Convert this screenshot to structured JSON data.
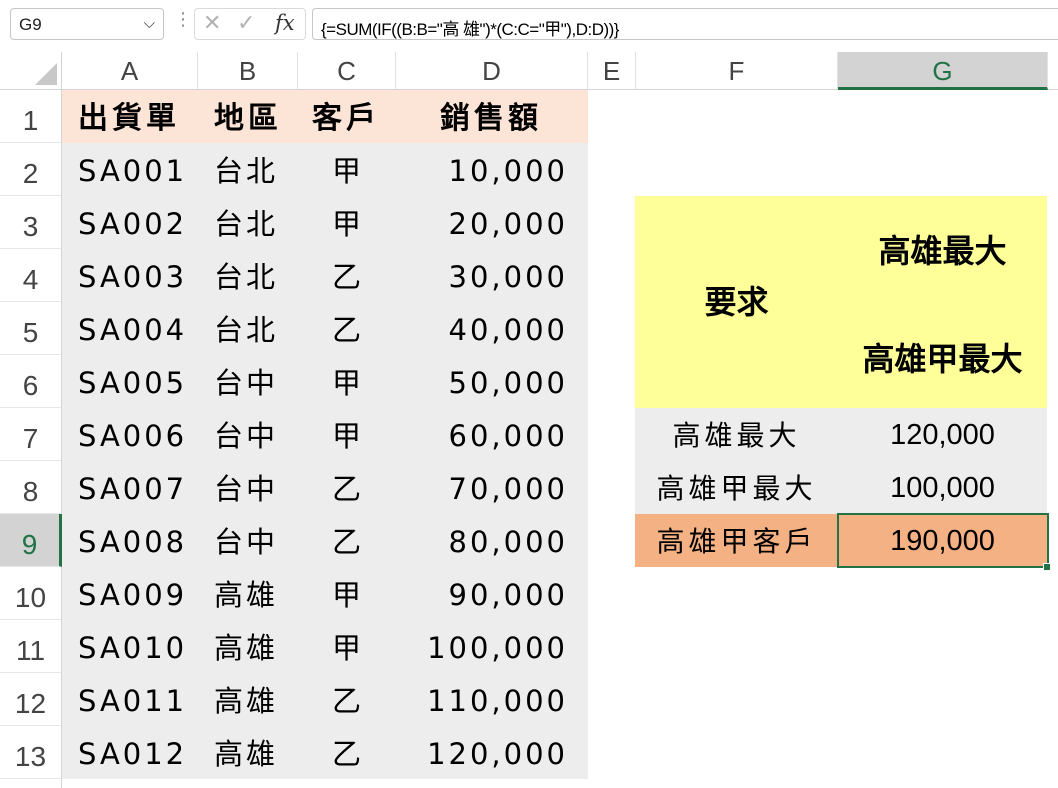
{
  "formula_bar": {
    "name_box": "G9",
    "dropdown_arrow": "⌵",
    "more_dots": "⋮",
    "cancel_icon": "✕",
    "enter_icon": "✓",
    "fx_label": "fx",
    "formula": "{=SUM(IF((B:B=\"高 雄\")*(C:C=\"甲\"),D:D))}"
  },
  "columns": [
    "A",
    "B",
    "C",
    "D",
    "E",
    "F",
    "G"
  ],
  "selected_column": "G",
  "rows": [
    "1",
    "2",
    "3",
    "4",
    "5",
    "6",
    "7",
    "8",
    "9",
    "10",
    "11",
    "12",
    "13"
  ],
  "selected_row": "9",
  "table": {
    "headers": [
      "出貨單",
      "地區",
      "客戶",
      "銷售額"
    ],
    "records": [
      [
        "SA001",
        "台北",
        "甲",
        "10,000"
      ],
      [
        "SA002",
        "台北",
        "甲",
        "20,000"
      ],
      [
        "SA003",
        "台北",
        "乙",
        "30,000"
      ],
      [
        "SA004",
        "台北",
        "乙",
        "40,000"
      ],
      [
        "SA005",
        "台中",
        "甲",
        "50,000"
      ],
      [
        "SA006",
        "台中",
        "甲",
        "60,000"
      ],
      [
        "SA007",
        "台中",
        "乙",
        "70,000"
      ],
      [
        "SA008",
        "台中",
        "乙",
        "80,000"
      ],
      [
        "SA009",
        "高雄",
        "甲",
        "90,000"
      ],
      [
        "SA010",
        "高雄",
        "甲",
        "100,000"
      ],
      [
        "SA011",
        "高雄",
        "乙",
        "110,000"
      ],
      [
        "SA012",
        "高雄",
        "乙",
        "120,000"
      ]
    ]
  },
  "summary": {
    "requirement_label": "要求",
    "requirement_line1": "高雄最大",
    "requirement_line2": "高雄甲最大",
    "rows": [
      {
        "label": "高雄最大",
        "value": "120,000"
      },
      {
        "label": "高雄甲最大",
        "value": "100,000"
      },
      {
        "label": "高雄甲客戶",
        "value": "190,000"
      }
    ]
  },
  "colors": {
    "header_fill": "#fce4d6",
    "data_fill": "#ededed",
    "requirement_fill": "#ffff99",
    "highlight_fill": "#f4b183",
    "selection_accent": "#217346"
  }
}
